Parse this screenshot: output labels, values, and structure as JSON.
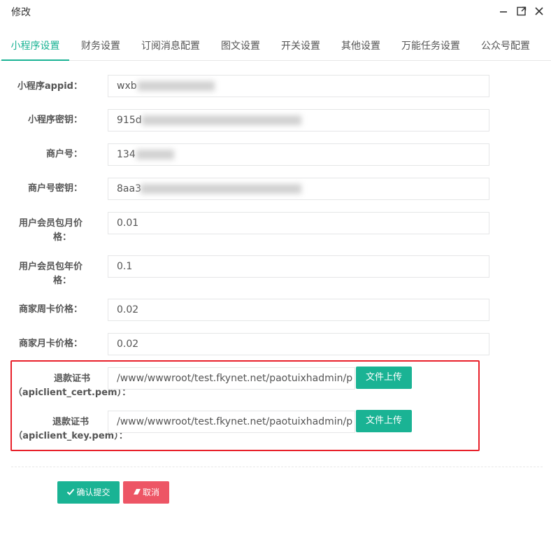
{
  "window": {
    "title": "修改"
  },
  "icons": {
    "minimize": "minimize-icon",
    "maximize": "maximize-icon",
    "close": "close-icon",
    "check": "check-icon",
    "eraser": "eraser-icon"
  },
  "tabs": [
    {
      "label": "小程序设置",
      "active": true
    },
    {
      "label": "财务设置"
    },
    {
      "label": "订阅消息配置"
    },
    {
      "label": "图文设置"
    },
    {
      "label": "开关设置"
    },
    {
      "label": "其他设置"
    },
    {
      "label": "万能任务设置"
    },
    {
      "label": "公众号配置"
    }
  ],
  "fields": [
    {
      "label": "小程序appid：",
      "value": "wxb"
    },
    {
      "label": "小程序密钥：",
      "value": "915d"
    },
    {
      "label": "商户号：",
      "value": "134"
    },
    {
      "label": "商户号密钥：",
      "value": "8aa3"
    },
    {
      "label_line1": "用户会员包月价",
      "label_line2": "格：",
      "value": "0.01"
    },
    {
      "label_line1": "用户会员包年价",
      "label_line2": "格：",
      "value": "0.1"
    },
    {
      "label": "商家周卡价格：",
      "value": "0.02"
    },
    {
      "label": "商家月卡价格：",
      "value": "0.02"
    }
  ],
  "certs": [
    {
      "label_line1": "退款证书",
      "label_line2": "（apiclient_cert.pem）：",
      "value": "/www/wwwroot/test.fkynet.net/paotuixhadmin/p",
      "button": "文件上传"
    },
    {
      "label_line1": "退款证书",
      "label_line2": "（apiclient_key.pem）：",
      "value": "/www/wwwroot/test.fkynet.net/paotuixhadmin/p",
      "button": "文件上传"
    }
  ],
  "actions": {
    "submit": "确认提交",
    "cancel": "取消"
  },
  "colors": {
    "accent": "#1ab394",
    "danger": "#ed5565",
    "highlight_border": "#e8202a"
  }
}
